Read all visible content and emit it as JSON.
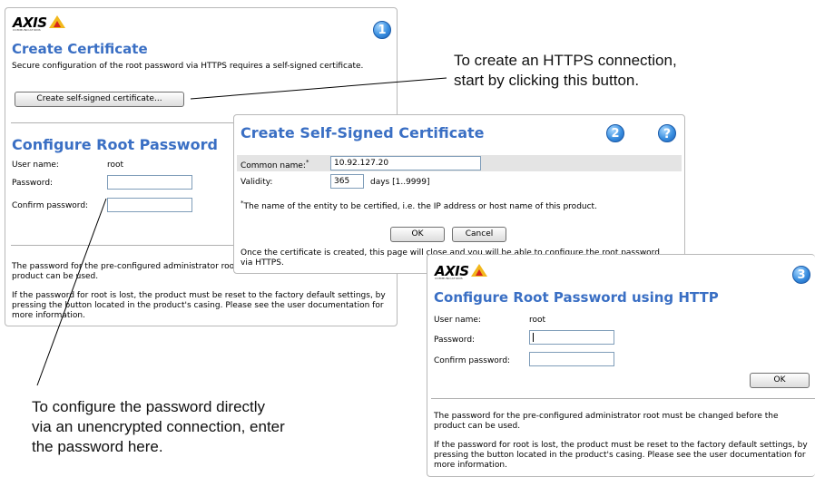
{
  "brand": {
    "logo": "AXIS",
    "tagline": "COMMUNICATIONS"
  },
  "panel1": {
    "badge": "1",
    "title": "Create Certificate",
    "desc": "Secure configuration of the root password via HTTPS requires a self-signed certificate.",
    "create_button": "Create self-signed certificate...",
    "section_title": "Configure Root Password",
    "username_label": "User name:",
    "username_value": "root",
    "password_label": "Password:",
    "confirm_label": "Confirm password:",
    "note1": "The password for the pre-configured administrator root must be changed before the product can be used.",
    "note2": "If the password for root is lost, the product must be reset to the factory default settings, by pressing the button located in the product's casing. Please see the user documentation for more information."
  },
  "panel2": {
    "badge": "2",
    "help": "?",
    "title": "Create Self-Signed Certificate",
    "common_name_label": "Common name:",
    "common_name_required": "*",
    "common_name_value": "10.92.127.20",
    "validity_label": "Validity:",
    "validity_value": "365",
    "validity_unit": "days [1..9999]",
    "footnote_mark": "*",
    "footnote": "The name of the entity to be certified, i.e. the IP address or host name of this product.",
    "ok_button": "OK",
    "cancel_button": "Cancel",
    "info": "Once the certificate is created, this page will close and you will be able to configure the root password via HTTPS."
  },
  "panel3": {
    "badge": "3",
    "title": "Configure Root Password using HTTP",
    "username_label": "User name:",
    "username_value": "root",
    "password_label": "Password:",
    "confirm_label": "Confirm password:",
    "ok_button": "OK",
    "note1": "The password for the pre-configured administrator root must be changed before the product can be used.",
    "note2": "If the password for root is lost, the product must be reset to the factory default settings, by pressing the button located in the product's casing. Please see the user documentation for more information."
  },
  "callouts": {
    "https_line1": "To create an HTTPS connection,",
    "https_line2": "start by clicking this button.",
    "direct_line1": "To configure the password directly",
    "direct_line2": "via an unencrypted connection, enter",
    "direct_line3": "the password here."
  },
  "colors": {
    "title_blue": "#3a6fc4",
    "badge_blue": "#3a8fe0",
    "logo_yellow": "#f2b81c",
    "logo_red": "#d8261c"
  }
}
